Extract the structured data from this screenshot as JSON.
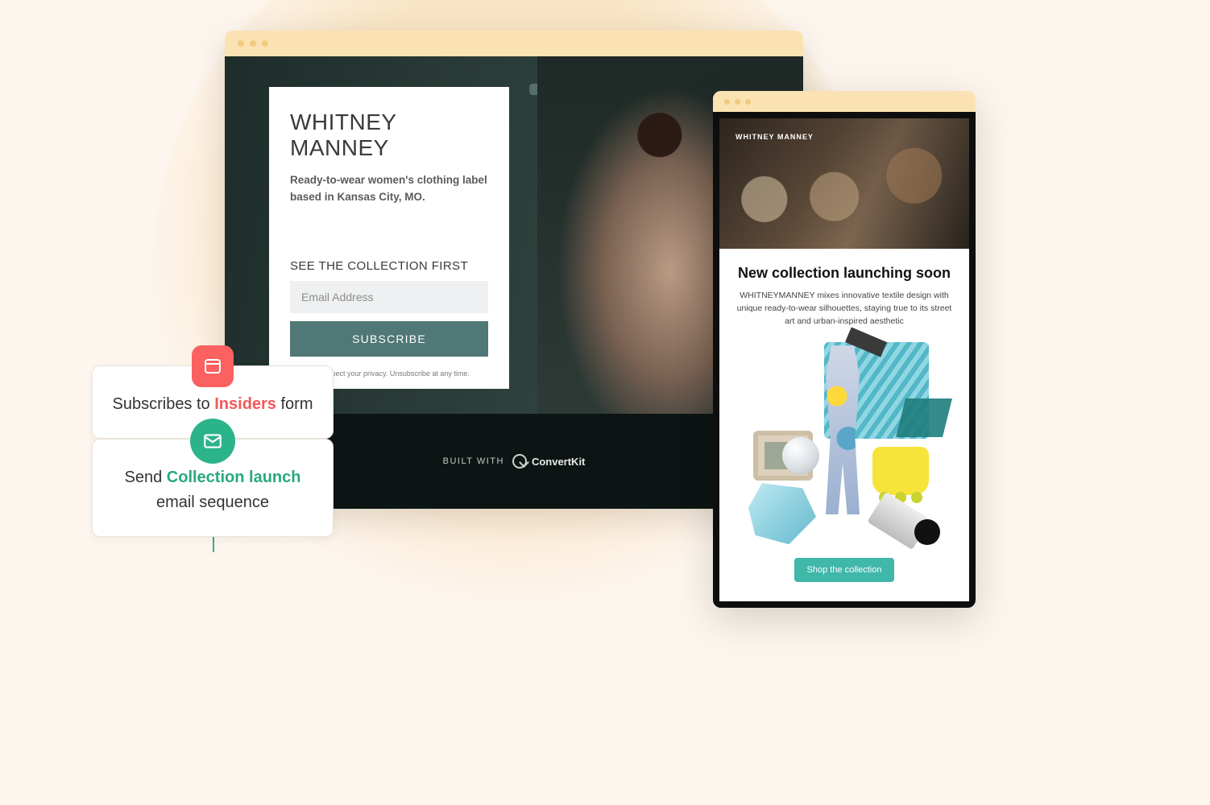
{
  "landing": {
    "brand_title": "WHITNEY MANNEY",
    "tagline": "Ready-to-wear women's clothing label based in Kansas City, MO.",
    "collection_heading": "SEE THE COLLECTION FIRST",
    "email_placeholder": "Email Address",
    "subscribe_label": "SUBSCRIBE",
    "privacy_text": "We respect your privacy. Unsubscribe at any time.",
    "built_with_label": "BUILT WITH",
    "built_with_brand": "ConvertKit"
  },
  "email_preview": {
    "brand_small": "WHITNEY MANNEY",
    "headline": "New collection launching soon",
    "body": "WHITNEYMANNEY mixes innovative textile design with unique ready-to-wear silhouettes, staying true to its street art and urban-inspired aesthetic",
    "cta_label": "Shop the collection"
  },
  "automation": {
    "step1_pre": "Subscribes to ",
    "step1_highlight": "Insiders",
    "step1_post": " form",
    "step2_pre": "Send ",
    "step2_highlight": "Collection launch",
    "step2_post": " email sequence"
  },
  "colors": {
    "accent_red": "#fb6161",
    "accent_green": "#2bb38a",
    "accent_teal": "#3fb7a9",
    "subscribe_btn": "#4f7876"
  }
}
